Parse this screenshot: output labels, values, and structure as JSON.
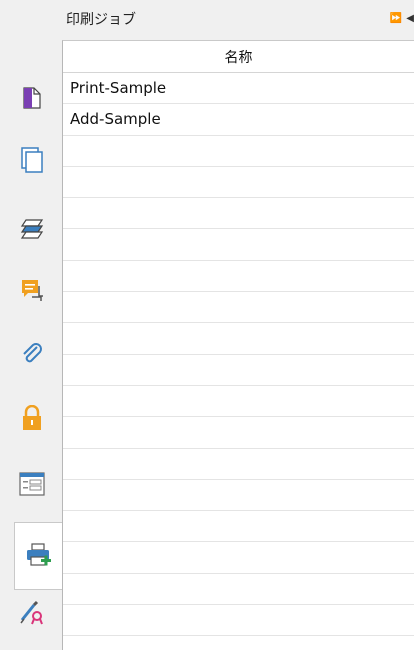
{
  "panel": {
    "title": "印刷ジョブ",
    "controls": {
      "expand": "⏩",
      "collapse": "◀"
    }
  },
  "grid": {
    "column_header": "名称",
    "rows": [
      "Print-Sample",
      "Add-Sample",
      "",
      "",
      "",
      "",
      "",
      "",
      "",
      "",
      "",
      "",
      "",
      "",
      "",
      "",
      "",
      ""
    ]
  },
  "rail": {
    "items": [
      {
        "icon": "page-icon",
        "color": "#7a3fb3"
      },
      {
        "icon": "pages-icon",
        "color": "#3b7fbf"
      },
      {
        "icon": "layers-icon",
        "color": "#3b7fbf"
      },
      {
        "icon": "comments-icon",
        "color": "#f0a020"
      },
      {
        "icon": "attachment-icon",
        "color": "#3b7fbf"
      },
      {
        "icon": "lock-icon",
        "color": "#f0a020"
      },
      {
        "icon": "form-fields-icon",
        "color": "#3b7fbf"
      },
      {
        "icon": "print-jobs-icon",
        "color": "#3b7fbf",
        "active": true
      },
      {
        "icon": "signature-icon",
        "color": "#3b7fbf"
      }
    ]
  }
}
